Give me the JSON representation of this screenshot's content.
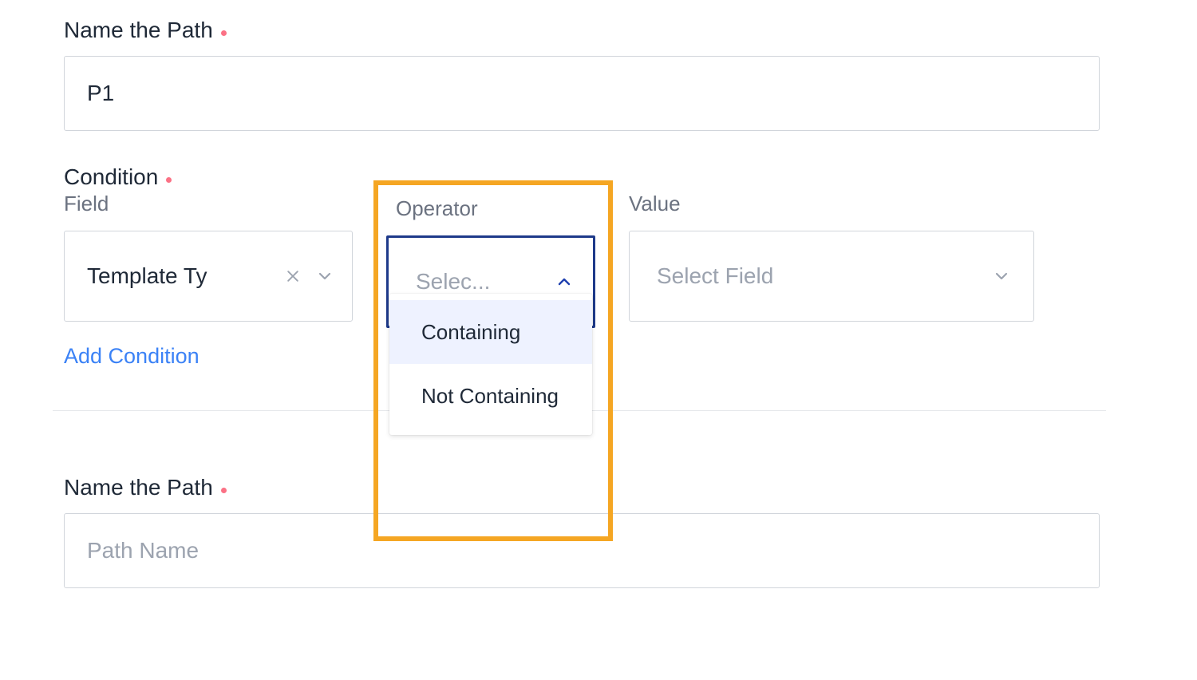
{
  "path1": {
    "name_label": "Name the Path",
    "name_value": "P1"
  },
  "condition": {
    "header": "Condition",
    "field_label": "Field",
    "operator_label": "Operator",
    "value_label": "Value",
    "field_value": "Template Ty",
    "operator_placeholder": "Selec...",
    "value_placeholder": "Select Field",
    "options": [
      "Containing",
      "Not Containing"
    ],
    "add_condition": "Add Condition"
  },
  "path2": {
    "name_label": "Name the Path",
    "name_placeholder": "Path Name"
  },
  "colors": {
    "highlight_border": "#f5a623",
    "focus_border": "#1e3a8a",
    "link": "#3b82f6",
    "required_dot": "#fb7185"
  }
}
